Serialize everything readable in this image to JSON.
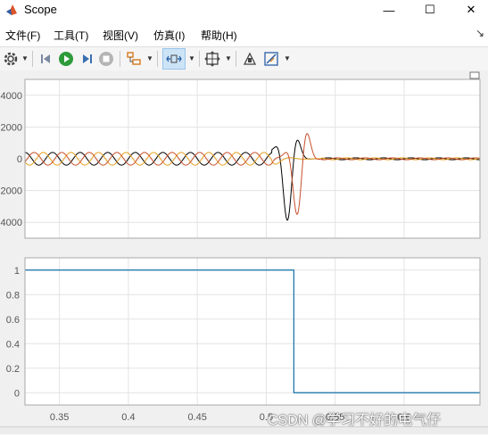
{
  "window": {
    "title": "Scope",
    "minimize_glyph": "—",
    "maximize_glyph": "☐",
    "close_glyph": "✕"
  },
  "menu": {
    "items": [
      "文件(F)",
      "工具(T)",
      "视图(V)",
      "仿真(I)",
      "帮助(H)"
    ],
    "overflow_glyph": "↘"
  },
  "toolbar": {
    "buttons": [
      "settings-icon",
      "step-back-icon",
      "run-icon",
      "step-forward-icon",
      "stop-icon",
      "layout-icon",
      "zoom-time-icon",
      "fit-view-icon",
      "highlight-icon",
      "measure-icon"
    ],
    "active": "zoom-time-icon"
  },
  "colors": {
    "series_black": "#000000",
    "series_orange": "#e6a01e",
    "series_red": "#c8502a",
    "step_blue": "#0f6fa8",
    "grid": "#e3e3e3",
    "tick": "#555555"
  },
  "watermark": "CSDN @学习不好的电气仔",
  "chart_data": [
    {
      "type": "line",
      "xlim": [
        0.325,
        0.655
      ],
      "ylim": [
        -5000,
        5000
      ],
      "y_ticks": [
        4000,
        2000,
        0,
        -2000,
        -4000
      ],
      "y_tick_labels": [
        "4000",
        "2000",
        "0",
        "2000",
        "4000"
      ],
      "grid": true,
      "series": [
        {
          "color": "#000000",
          "description_hint": "three-phase waveform, ~400 amplitude, 50 Hz; fault transient near t=0.51 peaking ~4000",
          "phase_deg": 0
        },
        {
          "color": "#e6a01e",
          "phase_deg": 120
        },
        {
          "color": "#c8502a",
          "phase_deg": 240
        }
      ],
      "pre_fault_amplitude": 400,
      "fault_time": 0.51,
      "transient_peak": 3900
    },
    {
      "type": "line",
      "xlim": [
        0.325,
        0.655
      ],
      "ylim": [
        -0.1,
        1.1
      ],
      "x_ticks": [
        0.35,
        0.4,
        0.45,
        0.5,
        0.55,
        0.6
      ],
      "x_tick_labels": [
        "0.35",
        "0.4",
        "0.45",
        "0.5",
        "0.55",
        "0.6"
      ],
      "y_ticks": [
        1,
        0.8,
        0.6,
        0.4,
        0.2,
        0
      ],
      "y_tick_labels": [
        "1",
        "0.8",
        "0.6",
        "0.4",
        "0.2",
        "0"
      ],
      "grid": true,
      "series": [
        {
          "color": "#0f6fa8",
          "x": [
            0.325,
            0.52,
            0.52,
            0.655
          ],
          "y": [
            1,
            1,
            0,
            0
          ]
        }
      ]
    }
  ]
}
